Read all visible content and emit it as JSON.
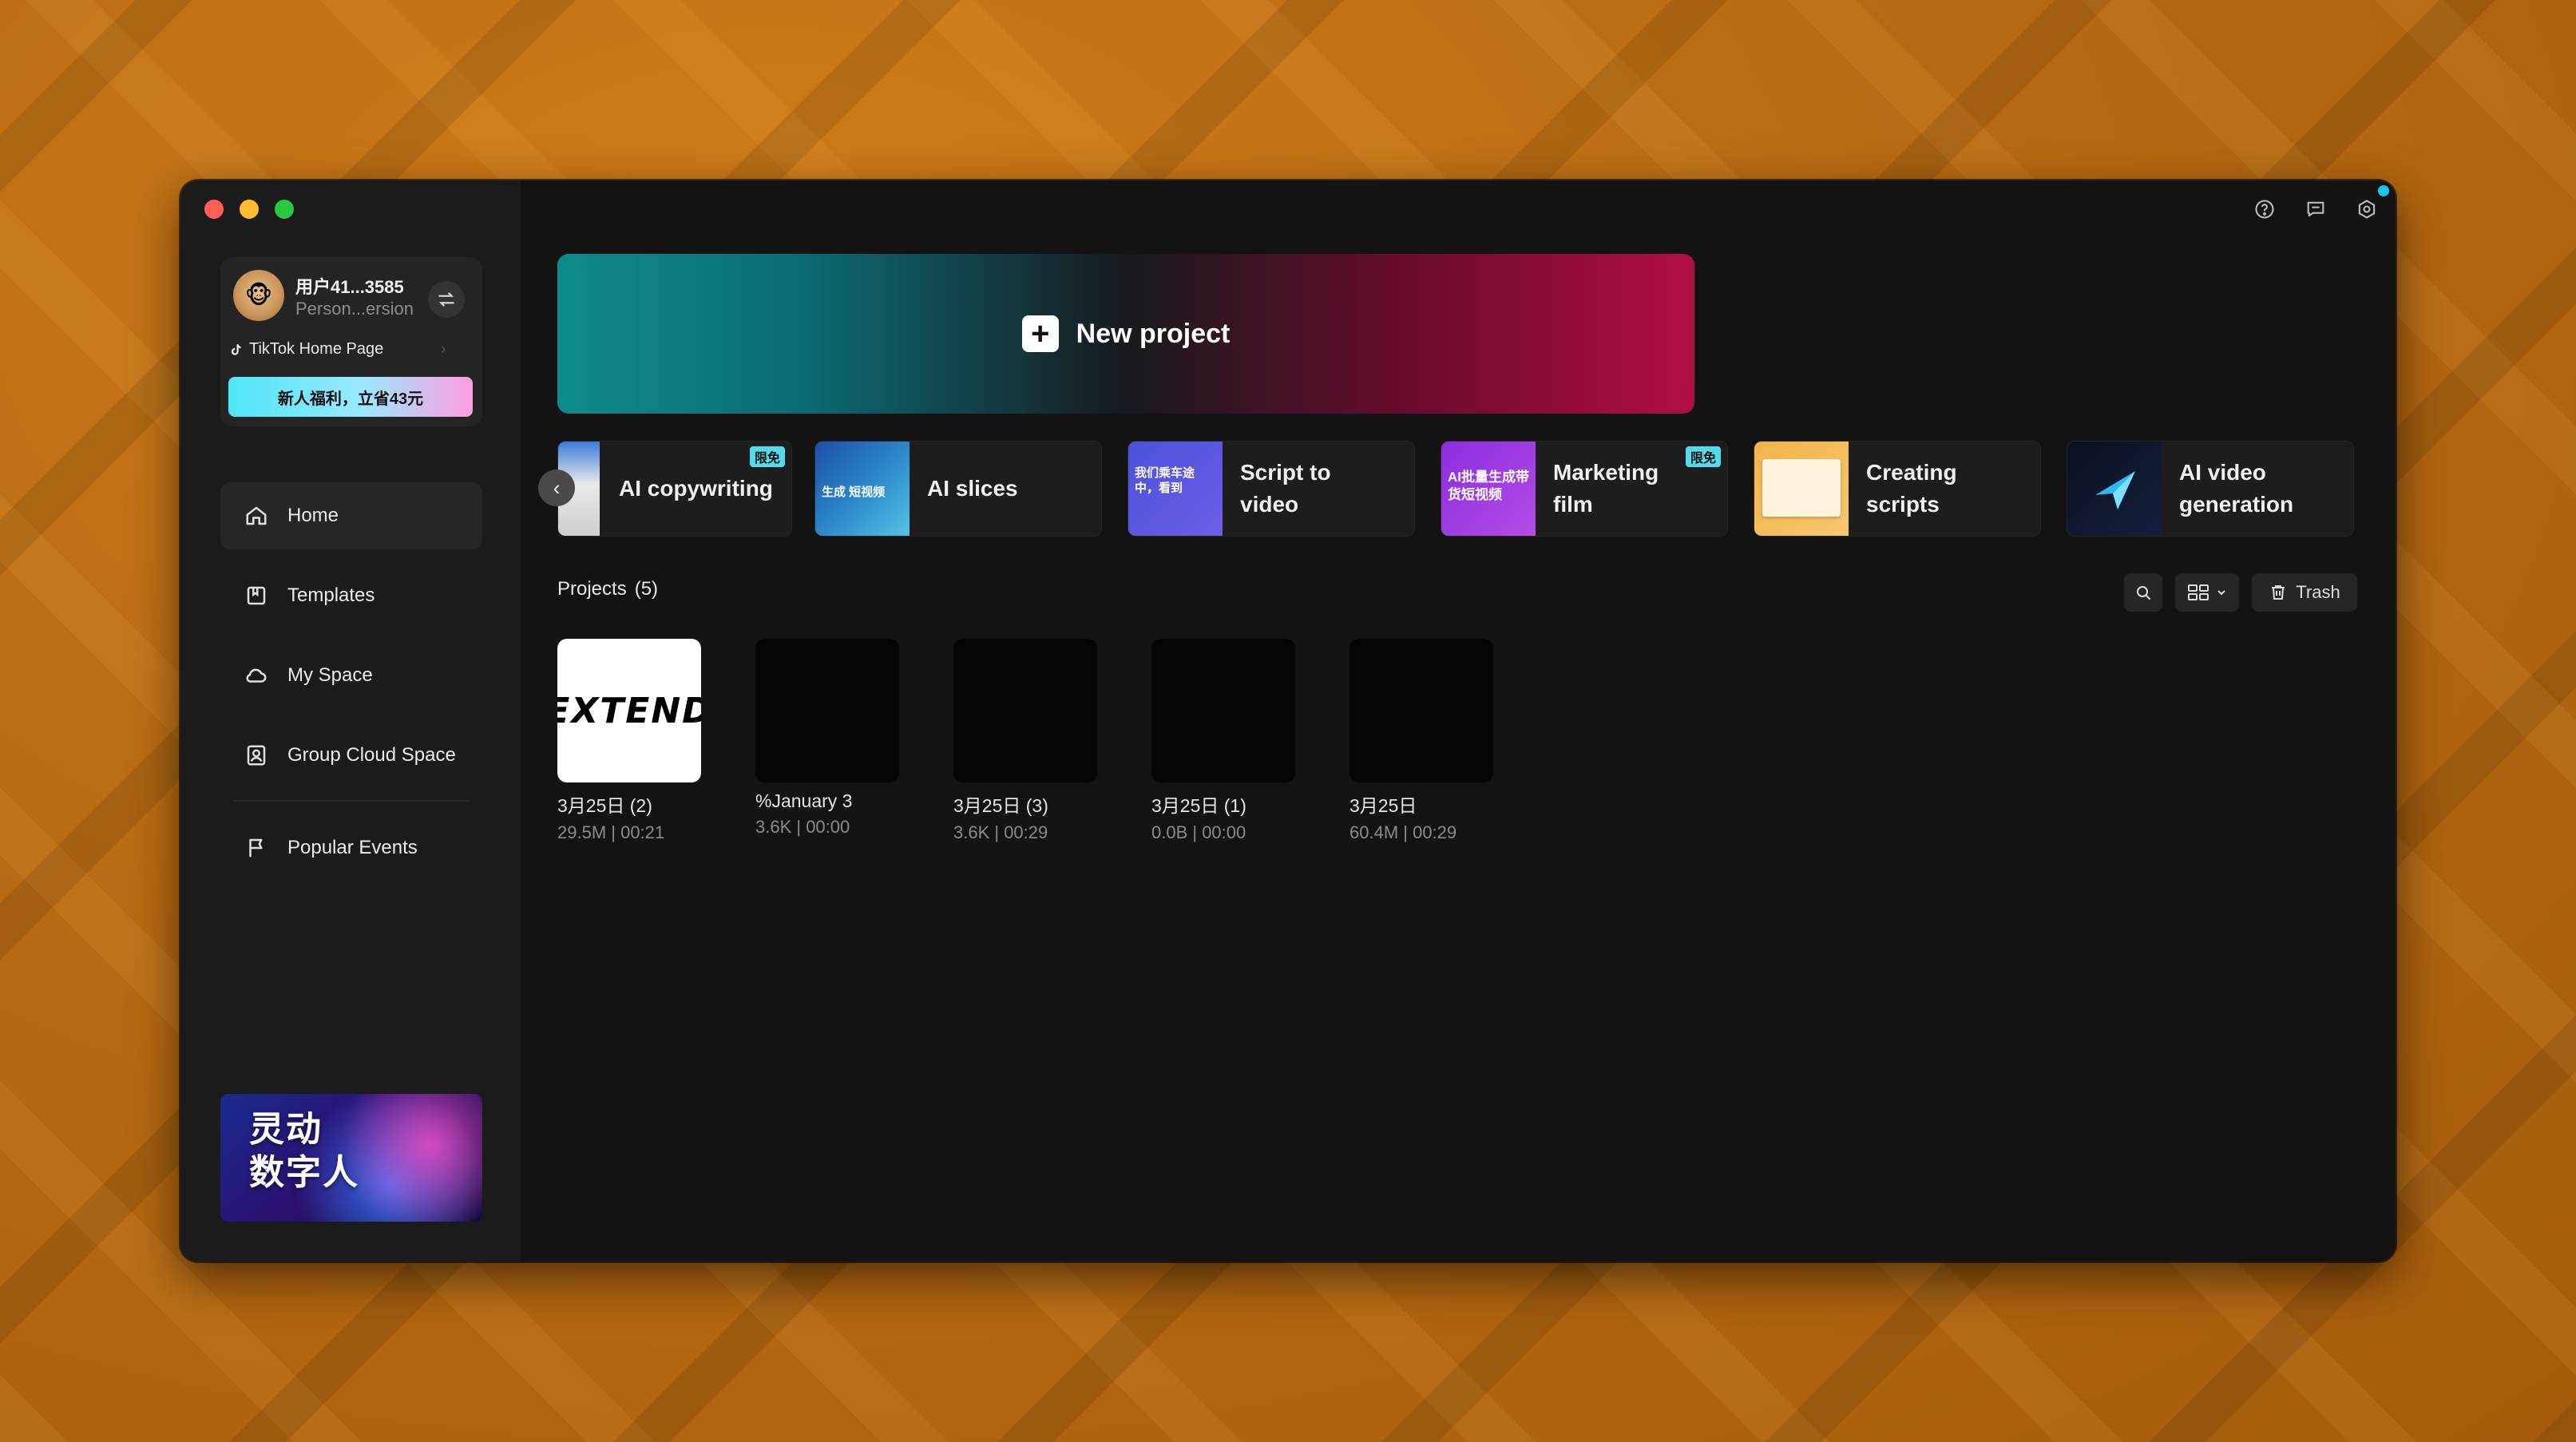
{
  "user": {
    "name": "用户41...3585",
    "plan": "Person...ersion",
    "tiktok_link": "TikTok Home Page",
    "promo": "新人福利，立省43元"
  },
  "nav": {
    "home": "Home",
    "templates": "Templates",
    "my_space": "My Space",
    "group_cloud": "Group Cloud Space",
    "popular_events": "Popular Events"
  },
  "banner": {
    "text_line1": "灵动",
    "text_line2": "数字人"
  },
  "new_project": {
    "label": "New project"
  },
  "features": [
    {
      "label": "AI copywriting",
      "badge": "限免"
    },
    {
      "label": "AI slices",
      "thumb_text": "生成\n短视频"
    },
    {
      "label": "Script to video",
      "thumb_text": "我们乘车途中，看到"
    },
    {
      "label": "Marketing film",
      "badge": "限免",
      "thumb_text": "AI批量生成带货短视频"
    },
    {
      "label": "Creating scripts"
    },
    {
      "label": "AI video generation"
    }
  ],
  "projects": {
    "title": "Projects",
    "count": "(5)",
    "trash_label": "Trash",
    "items": [
      {
        "title": "3月25日 (2)",
        "meta": "29.5M | 00:21",
        "thumb_text": "EXTEND"
      },
      {
        "title": "%January 3",
        "meta": "3.6K | 00:00"
      },
      {
        "title": "3月25日 (3)",
        "meta": "3.6K | 00:29"
      },
      {
        "title": "3月25日 (1)",
        "meta": "0.0B | 00:00"
      },
      {
        "title": "3月25日",
        "meta": "60.4M | 00:29"
      }
    ]
  },
  "colors": {
    "accent_cyan": "#52dbe8",
    "window_bg": "#131313",
    "sidebar_bg": "#1b1b1b"
  }
}
